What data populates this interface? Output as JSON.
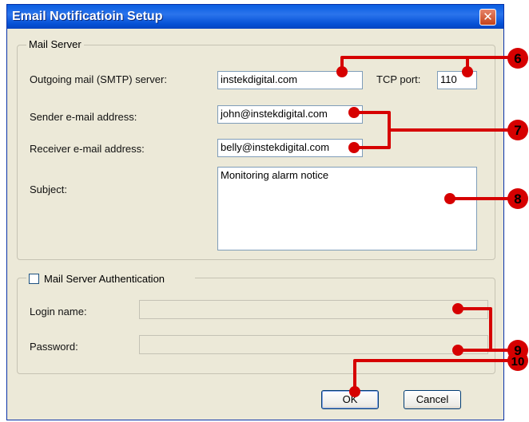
{
  "window": {
    "title": "Email Notificatioin Setup",
    "close_glyph": "✕"
  },
  "mail_server": {
    "legend": "Mail Server",
    "smtp_label": "Outgoing mail (SMTP) server:",
    "smtp_value": "instekdigital.com",
    "port_label": "TCP port:",
    "port_value": "110",
    "sender_label": "Sender e-mail address:",
    "sender_value": "john@instekdigital.com",
    "receiver_label": "Receiver e-mail address:",
    "receiver_value": "belly@instekdigital.com",
    "subject_label": "Subject:",
    "subject_value": "Monitoring alarm notice"
  },
  "auth": {
    "legend": "Mail Server Authentication",
    "checked": false,
    "login_label": "Login name:",
    "login_value": "",
    "password_label": "Password:",
    "password_value": ""
  },
  "buttons": {
    "ok": "OK",
    "cancel": "Cancel"
  },
  "callouts": {
    "color": "#d60000",
    "six": "6",
    "seven": "7",
    "eight": "8",
    "nine": "9",
    "ten": "10"
  },
  "colors": {
    "titlebar": "#0a5ee0",
    "dialog_bg": "#ece9d8",
    "close": "#c4431b"
  }
}
